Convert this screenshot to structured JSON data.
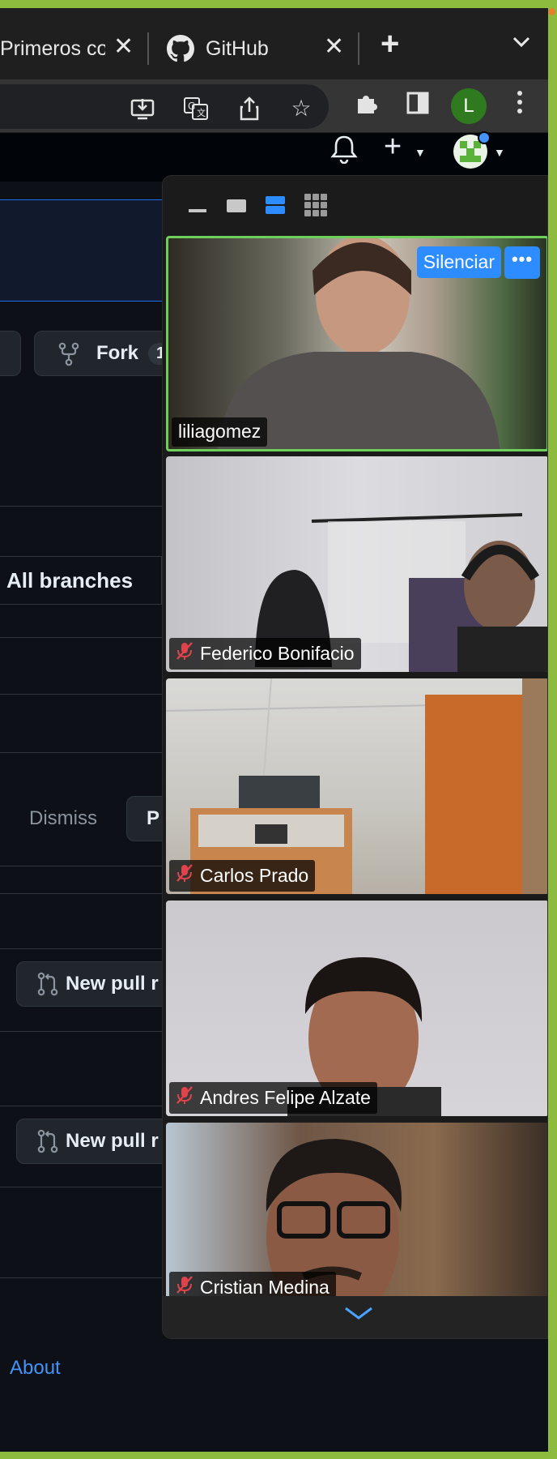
{
  "browser": {
    "tabs": [
      {
        "title": "Primeros co",
        "icon": "document-icon"
      },
      {
        "title": "GitHub",
        "icon": "github-icon"
      }
    ],
    "new_tab_label": "+",
    "profile_initial": "L"
  },
  "github": {
    "fork_label": "Fork",
    "fork_count": "1",
    "all_branches_label": "All branches",
    "dismiss_label": "Dismiss",
    "primary_button_partial": "P",
    "new_pull_request_partial": "New pull r",
    "about_label": "About"
  },
  "meeting": {
    "silenciar_label": "Silenciar",
    "more_label": "•••",
    "participants": [
      {
        "name": "liliagomez",
        "muted": false,
        "active": true
      },
      {
        "name": "Federico Bonifacio",
        "muted": true,
        "active": false
      },
      {
        "name": "Carlos Prado",
        "muted": true,
        "active": false
      },
      {
        "name": "Andres Felipe Alzate",
        "muted": true,
        "active": false
      },
      {
        "name": "Cristian Medina",
        "muted": true,
        "active": false
      }
    ]
  },
  "colors": {
    "desktop": "#8dbb3e",
    "github_bg": "#0d1117",
    "zoom_blue": "#2d8cff",
    "active_speaker": "#6ecf5a",
    "link": "#4493f8"
  }
}
